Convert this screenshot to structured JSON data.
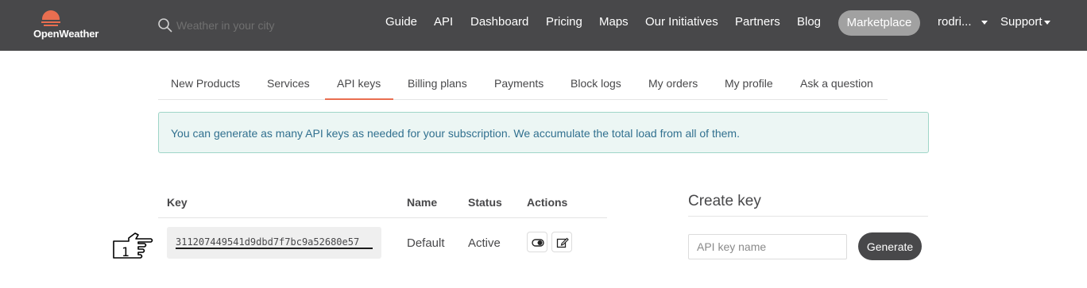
{
  "brand": {
    "name": "OpenWeather",
    "accent": "#e96e50",
    "header_bg": "#48484a"
  },
  "search": {
    "placeholder": "Weather in your city",
    "icon": "search-icon"
  },
  "nav": {
    "guide": "Guide",
    "api": "API",
    "dashboard": "Dashboard",
    "pricing": "Pricing",
    "maps": "Maps",
    "initiatives": "Our Initiatives",
    "partners": "Partners",
    "blog": "Blog",
    "marketplace": "Marketplace",
    "user": "rodri...",
    "support": "Support"
  },
  "tabs": [
    {
      "label": "New Products"
    },
    {
      "label": "Services"
    },
    {
      "label": "API keys",
      "active": true
    },
    {
      "label": "Billing plans"
    },
    {
      "label": "Payments"
    },
    {
      "label": "Block logs"
    },
    {
      "label": "My orders"
    },
    {
      "label": "My profile"
    },
    {
      "label": "Ask a question"
    }
  ],
  "alert": {
    "text": "You can generate as many API keys as needed for your subscription. We accumulate the total load from all of them."
  },
  "keys_table": {
    "headers": {
      "key": "Key",
      "name": "Name",
      "status": "Status",
      "actions": "Actions"
    },
    "rows": [
      {
        "key": "311207449541d9dbd7f7bc9a52680e57",
        "name": "Default",
        "status": "Active",
        "annotation": "1"
      }
    ],
    "action_icons": [
      "toggle-icon",
      "edit-icon"
    ]
  },
  "create_key": {
    "title": "Create key",
    "placeholder": "API key name",
    "button": "Generate"
  }
}
